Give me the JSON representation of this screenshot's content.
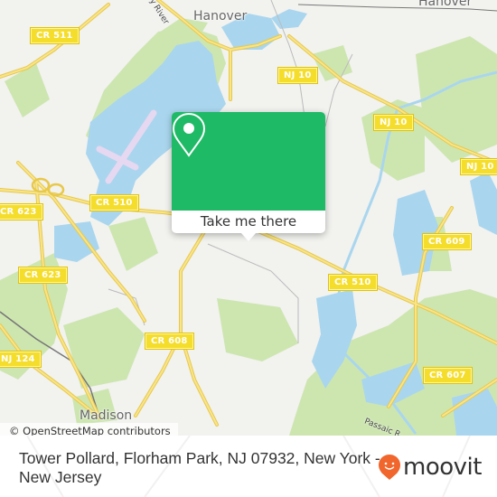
{
  "map": {
    "place_labels": [
      {
        "id": "hanover-west",
        "text": "Hanover"
      },
      {
        "id": "hanover-east",
        "text": "Hanover"
      },
      {
        "id": "madison",
        "text": "Madison"
      }
    ],
    "river_labels": [
      {
        "id": "whippany-river",
        "text": "y River"
      },
      {
        "id": "passaic-river",
        "text": "Passaic R"
      }
    ],
    "road_labels": [
      {
        "id": "cr-511",
        "text": "CR 511"
      },
      {
        "id": "nj-10-a",
        "text": "NJ 10"
      },
      {
        "id": "nj-10-b",
        "text": "NJ 10"
      },
      {
        "id": "nj-10-c",
        "text": "NJ 10"
      },
      {
        "id": "cr-623-a",
        "text": "CR 623"
      },
      {
        "id": "cr-510-a",
        "text": "CR 510"
      },
      {
        "id": "cr-609",
        "text": "CR 609"
      },
      {
        "id": "cr-623-b",
        "text": "CR 623"
      },
      {
        "id": "cr-510-b",
        "text": "CR 510"
      },
      {
        "id": "cr-608",
        "text": "CR 608"
      },
      {
        "id": "nj-124",
        "text": "NJ 124"
      },
      {
        "id": "cr-607",
        "text": "CR 607"
      }
    ],
    "attribution": "© OpenStreetMap contributors",
    "colors": {
      "land": "#f2f2ef",
      "park": "#cde6b0",
      "water": "#a9d6ee",
      "road": "#f5dd2b",
      "runway": "#e5d8f0"
    }
  },
  "popup": {
    "icon": "map-pin-icon",
    "button_label": "Take me there",
    "color": "#1eba66"
  },
  "footer": {
    "address": "Tower Pollard, Florham Park, NJ 07932, New York - New Jersey",
    "logo_text": "moovit",
    "logo_color": "#f0662d"
  }
}
